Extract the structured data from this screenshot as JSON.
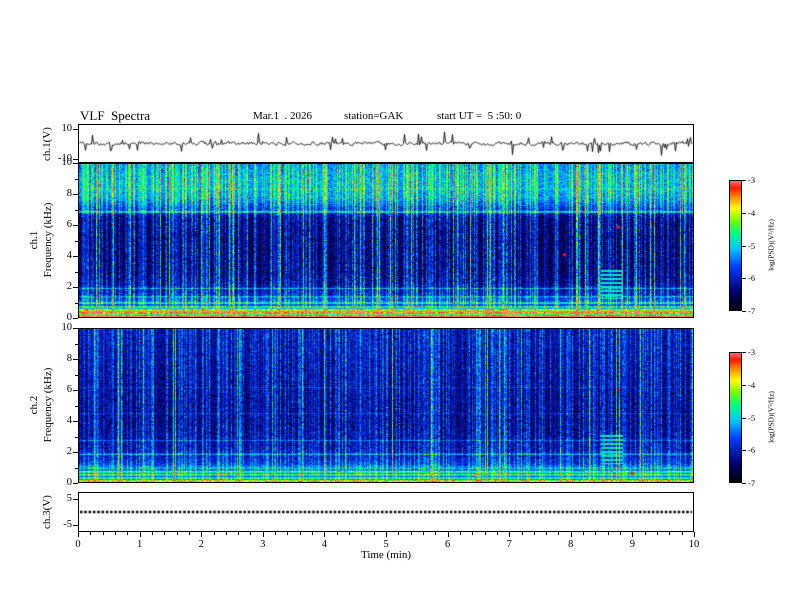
{
  "header": {
    "title": "VLF  Spectra",
    "date": "Mar.1  . 2026",
    "station": "station=GAK",
    "start_ut": "start UT =  5 :50: 0"
  },
  "panels": {
    "ch1_wave": {
      "label": "ch.1(V)",
      "tick_labels": [
        "10",
        "-10"
      ],
      "tick_values": [
        10,
        -10
      ],
      "y_full_scale": 13
    },
    "spec1": {
      "channel": "ch.1",
      "ylabel": "Frequency (kHz)",
      "tick_labels": [
        "10",
        "8",
        "6",
        "4",
        "2",
        "0"
      ],
      "tick_values": [
        10,
        8,
        6,
        4,
        2,
        0
      ]
    },
    "spec2": {
      "channel": "ch.2",
      "ylabel": "Frequency (kHz)",
      "tick_labels": [
        "10",
        "8",
        "6",
        "4",
        "2",
        "0"
      ],
      "tick_values": [
        10,
        8,
        6,
        4,
        2,
        0
      ]
    },
    "ch3_wave": {
      "label": "ch.3(V)",
      "tick_labels": [
        "5",
        "-5"
      ],
      "tick_values": [
        5,
        -5
      ],
      "y_full_scale": 7.5
    }
  },
  "xaxis": {
    "label": "Time (min)",
    "tick_labels": [
      "0",
      "1",
      "2",
      "3",
      "4",
      "5",
      "6",
      "7",
      "8",
      "9",
      "10"
    ],
    "tick_values": [
      0,
      1,
      2,
      3,
      4,
      5,
      6,
      7,
      8,
      9,
      10
    ],
    "minor_step_min": 0.2
  },
  "colorbar": {
    "label": "log(PSD)(V²/Hz)",
    "tick_labels": [
      "-3",
      "-4",
      "-5",
      "-6",
      "-7"
    ],
    "tick_values": [
      -3,
      -4,
      -5,
      -6,
      -7
    ],
    "max": -3,
    "min": -7
  },
  "colormap": [
    [
      0.0,
      [
        0,
        0,
        0
      ]
    ],
    [
      0.14,
      [
        0,
        0,
        110
      ]
    ],
    [
      0.34,
      [
        0,
        60,
        255
      ]
    ],
    [
      0.48,
      [
        0,
        200,
        255
      ]
    ],
    [
      0.6,
      [
        0,
        255,
        130
      ]
    ],
    [
      0.7,
      [
        120,
        255,
        0
      ]
    ],
    [
      0.79,
      [
        255,
        255,
        0
      ]
    ],
    [
      0.88,
      [
        255,
        140,
        0
      ]
    ],
    [
      0.95,
      [
        255,
        20,
        0
      ]
    ],
    [
      1.0,
      [
        255,
        110,
        110
      ]
    ]
  ],
  "chart_data": [
    {
      "type": "line",
      "name": "ch1_time_series",
      "xlabel": "Time (min)",
      "x_range": [
        0,
        10
      ],
      "ylabel": "ch.1(V)",
      "y_range": [
        -10,
        10
      ],
      "description": "Channel-1 VLF waveform: continuous noise around 0 V (about ±2 V) with frequent impulsive spikes up to roughly ±7 V over the full 10-minute record.",
      "gen": {
        "seed": 20260301,
        "sigma": 1.0,
        "spike_prob": 0.09,
        "spike_amp": 5.5,
        "y_full_scale": 13
      }
    },
    {
      "type": "heatmap",
      "name": "ch1_spectrogram",
      "xlabel": "Time (min)",
      "x_range": [
        0,
        10
      ],
      "ylabel": "Frequency (kHz)",
      "y_range": [
        0,
        10
      ],
      "zlabel": "log(PSD)(V²/Hz)",
      "z_range": [
        -7,
        -3
      ],
      "legend_position": "right-colorbar",
      "description": "Channel-1 dynamic spectrum: intense red/orange band below ~0.6 kHz, dark-blue background 2-7 kHz crossed by dense vertical sferic streaks, bright green/yellow speckle band above ~7.5 kHz, narrowband lines near 0.95, 1.35, 1.9 and 6.9 kHz, and an interference patch near 8.5-8.9 min between 1.2 and 3.2 kHz.",
      "gen": {
        "seed": 11,
        "fmax": 10,
        "noise": 0.2,
        "profile": [
          [
            0,
            0.95
          ],
          [
            0.35,
            0.88
          ],
          [
            0.55,
            0.72
          ],
          [
            0.8,
            0.45
          ],
          [
            1.05,
            0.32
          ],
          [
            1.5,
            0.22
          ],
          [
            2.2,
            0.15
          ],
          [
            3,
            0.12
          ],
          [
            5,
            0.11
          ],
          [
            6.5,
            0.13
          ],
          [
            7.2,
            0.3
          ],
          [
            7.8,
            0.42
          ],
          [
            9,
            0.44
          ],
          [
            10,
            0.4
          ]
        ],
        "streak_prob": 0.5,
        "streak_strength": 0.22,
        "big_streak_prob": 0.1,
        "hlines": [
          {
            "f": 6.9,
            "w": 0.07,
            "v": 0.3
          },
          {
            "f": 1.9,
            "w": 0.05,
            "v": 0.22
          },
          {
            "f": 1.35,
            "w": 0.05,
            "v": 0.2
          },
          {
            "f": 0.95,
            "w": 0.04,
            "v": 0.25
          },
          {
            "f": 8.4,
            "w": 0.04,
            "v": 0.1
          }
        ],
        "stripe_below": 0.9,
        "patch": {
          "t0": 8.5,
          "t1": 8.85,
          "f0": 1.2,
          "f1": 3.2,
          "v": 0.52
        },
        "dots": [
          {
            "t": 8.78,
            "f": 5.9
          },
          {
            "t": 7.9,
            "f": 4.1
          }
        ]
      }
    },
    {
      "type": "heatmap",
      "name": "ch2_spectrogram",
      "xlabel": "Time (min)",
      "x_range": [
        0,
        10
      ],
      "ylabel": "Frequency (kHz)",
      "y_range": [
        0,
        10
      ],
      "zlabel": "log(PSD)(V²/Hz)",
      "z_range": [
        -7,
        -3
      ],
      "legend_position": "right-colorbar",
      "description": "Channel-2 dynamic spectrum: darker overall than channel 1; blue speckle with vertical sferic streaks above 2 kHz, narrowband lines near 1.85 and 2.75 kHz, bright green/yellow band near 0.5-0.9 kHz, red at the lowest frequencies, and the same interference patch near 8.5-8.9 min.",
      "gen": {
        "seed": 22,
        "fmax": 10,
        "noise": 0.2,
        "profile": [
          [
            0,
            0.92
          ],
          [
            0.3,
            0.55
          ],
          [
            0.5,
            0.6
          ],
          [
            0.7,
            0.66
          ],
          [
            0.9,
            0.45
          ],
          [
            1.2,
            0.28
          ],
          [
            1.7,
            0.22
          ],
          [
            2.5,
            0.18
          ],
          [
            4,
            0.15
          ],
          [
            6,
            0.16
          ],
          [
            8,
            0.18
          ],
          [
            10,
            0.2
          ]
        ],
        "streak_prob": 0.5,
        "streak_strength": 0.18,
        "big_streak_prob": 0.05,
        "hlines": [
          {
            "f": 1.85,
            "w": 0.05,
            "v": 0.25
          },
          {
            "f": 2.75,
            "w": 0.05,
            "v": 0.15
          },
          {
            "f": 4.5,
            "w": 0.04,
            "v": 0.08
          },
          {
            "f": 6.2,
            "w": 0.04,
            "v": 0.07
          }
        ],
        "stripe_below": 0.95,
        "patch": {
          "t0": 8.5,
          "t1": 8.85,
          "f0": 1.2,
          "f1": 3.2,
          "v": 0.52
        },
        "dots": [
          {
            "t": 9.0,
            "f": 0.6
          }
        ]
      }
    },
    {
      "type": "line",
      "name": "ch3_time_series",
      "xlabel": "Time (min)",
      "x_range": [
        0,
        10
      ],
      "ylabel": "ch.3(V)",
      "y_range": [
        -5,
        5
      ],
      "description": "Channel-3 waveform: flat at 0 V (thick dotted trace) for the entire 10-minute record.",
      "gen": {
        "value": 0,
        "dash": [
          2.5,
          1.8
        ],
        "line_width": 2.4,
        "y_full_scale": 7.5
      }
    }
  ]
}
